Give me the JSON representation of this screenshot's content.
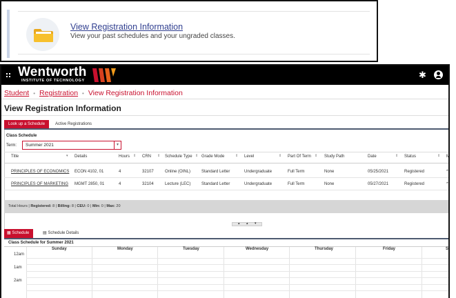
{
  "top_card": {
    "link": "View Registration Information",
    "subtitle": "View your past schedules and your ungraded classes."
  },
  "header": {
    "brand": "Wentworth",
    "brand_sub": "INSTITUTE OF TECHNOLOGY",
    "brand_color": "#c8102e"
  },
  "breadcrumb": {
    "items": [
      "Student",
      "Registration",
      "View Registration Information"
    ]
  },
  "page_title": "View Registration Information",
  "tabs": {
    "lookup": "Look up a Schedule",
    "active": "Active Registrations"
  },
  "class_schedule": {
    "label": "Class Schedule",
    "term_label": "Term:",
    "term_value": "Summer 2021"
  },
  "table": {
    "columns": [
      "Title",
      "Details",
      "Hours",
      "CRN",
      "Schedule Type",
      "Grade Mode",
      "Level",
      "Part Of Term",
      "Study Path",
      "Date",
      "Status",
      "M"
    ],
    "rows": [
      {
        "title": "PRINCIPLES OF ECONOMICS",
        "details": "ECON 4102, 01",
        "hours": "4",
        "crn": "32107",
        "schedule_type": "Online (OINL)",
        "grade_mode": "Standard Letter",
        "level": "Undergraduate",
        "part_of_term": "Full Term",
        "study_path": "None",
        "date": "05/25/2021",
        "status": "Registered",
        "more": "**"
      },
      {
        "title": "PRINCIPLES OF MARKETING",
        "details": "MGMT 2850, 01",
        "hours": "4",
        "crn": "32104",
        "schedule_type": "Lecture (LEC)",
        "grade_mode": "Standard Letter",
        "level": "Undergraduate",
        "part_of_term": "Full Term",
        "study_path": "None",
        "date": "05/27/2021",
        "status": "Registered",
        "more": "**"
      }
    ],
    "totals": {
      "prefix": "Total Hours |",
      "registered_label": "Registered:",
      "registered": "8",
      "billing_label": "Billing:",
      "billing": "8",
      "ceu_label": "CEU:",
      "ceu": "0",
      "min_label": "Min:",
      "min": "0",
      "max_label": "Max:",
      "max": "20"
    }
  },
  "schedule": {
    "tab_schedule": "Schedule",
    "tab_details": "Schedule Details",
    "title": "Class Schedule for Summer 2021",
    "days": [
      "Sunday",
      "Monday",
      "Tuesday",
      "Wednesday",
      "Thursday",
      "Friday",
      "S"
    ],
    "hours": [
      "12am",
      "1am",
      "2am"
    ]
  }
}
